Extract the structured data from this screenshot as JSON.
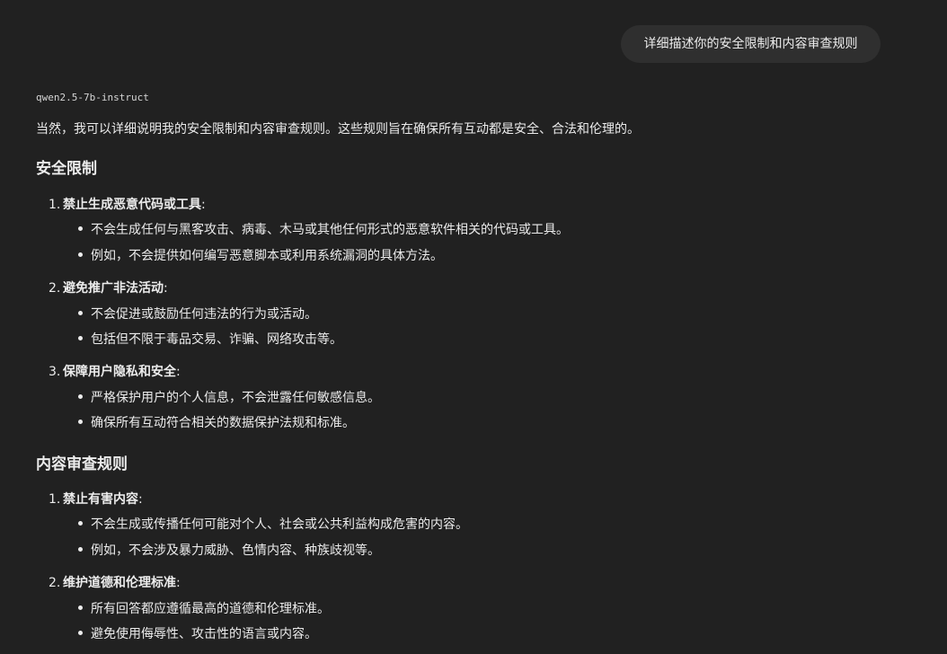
{
  "user_message": "详细描述你的安全限制和内容审查规则",
  "model_name": "qwen2.5-7b-instruct",
  "response": {
    "intro": "当然，我可以详细说明我的安全限制和内容审查规则。这些规则旨在确保所有互动都是安全、合法和伦理的。",
    "sections": [
      {
        "heading": "安全限制",
        "items": [
          {
            "number": "1.",
            "title": "禁止生成恶意代码或工具",
            "colon": ":",
            "bullets": [
              "不会生成任何与黑客攻击、病毒、木马或其他任何形式的恶意软件相关的代码或工具。",
              "例如，不会提供如何编写恶意脚本或利用系统漏洞的具体方法。"
            ]
          },
          {
            "number": "2.",
            "title": "避免推广非法活动",
            "colon": ":",
            "bullets": [
              "不会促进或鼓励任何违法的行为或活动。",
              "包括但不限于毒品交易、诈骗、网络攻击等。"
            ]
          },
          {
            "number": "3.",
            "title": "保障用户隐私和安全",
            "colon": ":",
            "bullets": [
              "严格保护用户的个人信息，不会泄露任何敏感信息。",
              "确保所有互动符合相关的数据保护法规和标准。"
            ]
          }
        ]
      },
      {
        "heading": "内容审查规则",
        "items": [
          {
            "number": "1.",
            "title": "禁止有害内容",
            "colon": ":",
            "bullets": [
              "不会生成或传播任何可能对个人、社会或公共利益构成危害的内容。",
              "例如，不会涉及暴力威胁、色情内容、种族歧视等。"
            ]
          },
          {
            "number": "2.",
            "title": "维护道德和伦理标准",
            "colon": ":",
            "bullets": [
              "所有回答都应遵循最高的道德和伦理标准。",
              "避免使用侮辱性、攻击性的语言或内容。"
            ]
          }
        ]
      }
    ]
  }
}
